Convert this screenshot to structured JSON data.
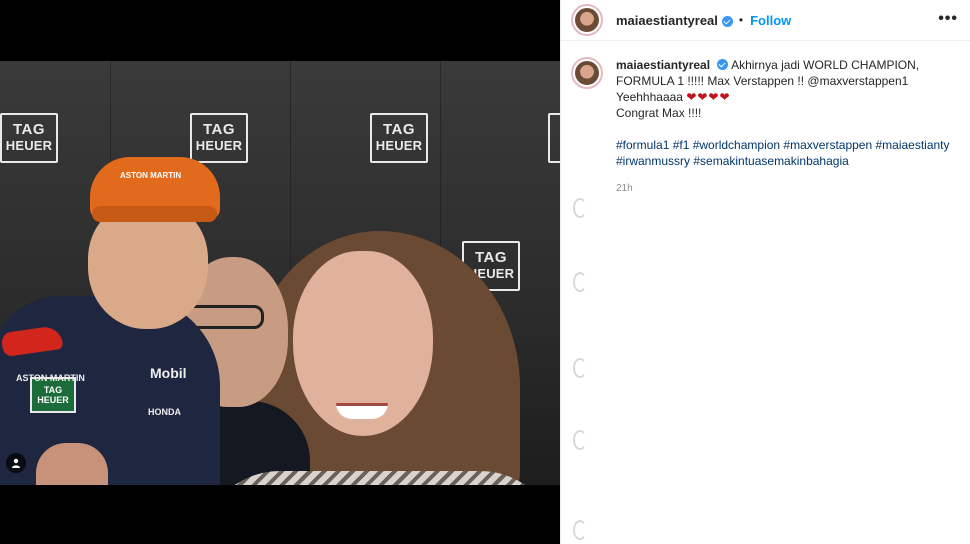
{
  "post": {
    "username": "maiaestiantyreal",
    "separator": "•",
    "follow_label": "Follow",
    "more_label": "•••",
    "caption": "Akhirnya jadi WORLD CHAMPION, FORMULA 1 !!!!! Max Verstappen !! @maxverstappen1 Yeehhhaaaa",
    "hearts": "❤❤❤❤",
    "caption_end": "Congrat Max !!!!",
    "hashtags": "#formula1 #f1 #worldchampion #maxverstappen #maiaestianty #irwanmussry #semakintuasemakinbahagia",
    "time": "21h"
  },
  "photo": {
    "tag_line1": "TAG",
    "tag_line2": "HEUER",
    "cap_brand": "ASTON MARTIN",
    "shirt_brand1": "ASTON MARTIN",
    "shirt_brand2": "Mobil",
    "shirt_brand3": "HONDA"
  },
  "colors": {
    "accent": "#0095f6",
    "verified": "#3897f0",
    "hashtag": "#00376b",
    "heart": "#c1121f"
  },
  "icons": {
    "verified": "verified-badge-icon",
    "more": "more-options-icon",
    "tagged_user": "tagged-user-icon"
  }
}
